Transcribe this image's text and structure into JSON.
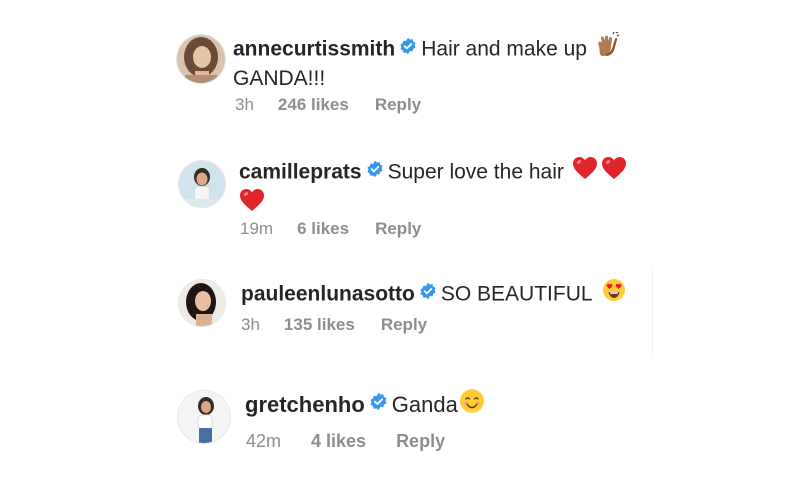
{
  "comments": [
    {
      "username": "annecurtissmith",
      "text": "Hair and make up",
      "text_line2": "GANDA!!!",
      "emoji": "clapping-hands",
      "time": "3h",
      "likes": "246 likes",
      "reply": "Reply"
    },
    {
      "username": "camilleprats",
      "text": "Super love the hair",
      "emoji": "red-heart",
      "time": "19m",
      "likes": "6 likes",
      "reply": "Reply"
    },
    {
      "username": "pauleenlunasotto",
      "text": "SO BEAUTIFUL",
      "emoji": "heart-eyes-face",
      "time": "3h",
      "likes": "135 likes",
      "reply": "Reply"
    },
    {
      "username": "gretchenho",
      "text": "Ganda",
      "emoji": "smiling-face",
      "time": "42m",
      "likes": "4 likes",
      "reply": "Reply"
    }
  ],
  "colors": {
    "verified": "#3897f0",
    "meta": "#8e8e8e",
    "text": "#262626",
    "heart": "#e0242b"
  }
}
